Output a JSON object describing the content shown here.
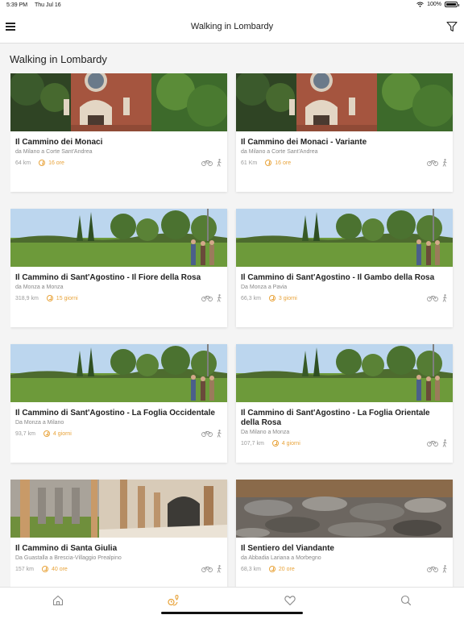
{
  "status_bar": {
    "time": "5:39 PM",
    "date": "Thu Jul 16",
    "battery": "100%"
  },
  "header": {
    "title": "Walking in Lombardy",
    "menu_icon": "hamburger-icon",
    "filter_icon": "filter-icon"
  },
  "page": {
    "heading": "Walking in Lombardy"
  },
  "colors": {
    "accent": "#e8a33a",
    "text": "#222222",
    "muted": "#888888"
  },
  "cards": [
    {
      "name": "Il Cammino dei Monaci",
      "route": "da Milano a Corte Sant'Andrea",
      "distance": "64 km",
      "duration": "16 ore",
      "photo": "church-photo"
    },
    {
      "name": "Il Cammino dei Monaci - Variante",
      "route": "da Milano a Corte Sant'Andrea",
      "distance": "61 Km",
      "duration": "16 ore",
      "photo": "church-photo"
    },
    {
      "name": "Il Cammino di Sant'Agostino - Il Fiore della Rosa",
      "route": "da Monza a Monza",
      "distance": "318,9 km",
      "duration": "15 giorni",
      "photo": "field-photo"
    },
    {
      "name": "Il Cammino di Sant'Agostino - Il Gambo della Rosa",
      "route": "Da Monza a Pavia",
      "distance": "66,3 km",
      "duration": "3 giorni",
      "photo": "field-photo"
    },
    {
      "name": "Il Cammino di Sant'Agostino - La Foglia Occidentale",
      "route": "Da Monza a Milano",
      "distance": "93,7 km",
      "duration": "4 giorni",
      "photo": "field-photo"
    },
    {
      "name": "Il Cammino di Sant'Agostino - La Foglia Orientale della Rosa",
      "route": "Da Milano a Monza",
      "distance": "107,7 km",
      "duration": "4 giorni",
      "photo": "field-photo"
    },
    {
      "name": "Il Cammino di Santa Giulia",
      "route": "Da Guastalla a Brescia-Villaggio Prealpino",
      "distance": "157 km",
      "duration": "40 ore",
      "photo": "cloister-photo"
    },
    {
      "name": "Il Sentiero del Viandante",
      "route": "da Abbadia Lariana a Morbegno",
      "distance": "68,3 km",
      "duration": "20 ore",
      "photo": "rocks-photo"
    }
  ],
  "tabs": [
    {
      "name": "home",
      "icon": "home-icon"
    },
    {
      "name": "routes",
      "icon": "route-icon"
    },
    {
      "name": "favorites",
      "icon": "heart-icon"
    },
    {
      "name": "search",
      "icon": "search-icon"
    }
  ]
}
